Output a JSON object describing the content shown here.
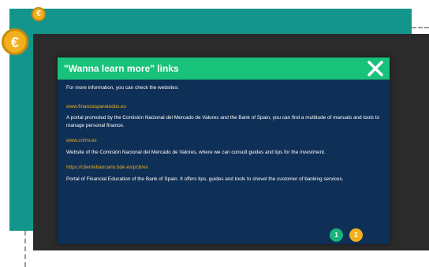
{
  "icons": {
    "coin_small": "euro-coin-icon",
    "coin_large": "euro-coin-icon",
    "close": "close-icon"
  },
  "colors": {
    "teal": "#14958b",
    "modal_bg": "#0e2f56",
    "header_green": "#19c27a",
    "link_yellow": "#f2b01e"
  },
  "coin_small_symbol": "€",
  "coin_large_symbol": "€",
  "modal": {
    "title": "\"Wanna learn more\" links",
    "intro": "For more information, you can check the websites:",
    "links": [
      {
        "url": "www.finanzasparatodos.es",
        "description": "A portal promoted by the Comisión Nacional del Mercado de Valores and the Bank of Spain, you can find a multitude of manuals and tools to manage personal finance."
      },
      {
        "url": "www.cnmv.es",
        "description": "Website of the Comisión Nacional del Mercado de Valores, where we can consult guides and tips for the investment."
      },
      {
        "url": "https://clientebancario.bde.es/pcb/es",
        "description": "Portal of Financial Education of the Bank of Spain. It offers tips, guides and tools to shovel the customer of banking services."
      }
    ],
    "pagination": {
      "page1": "1",
      "page2": "2"
    }
  }
}
